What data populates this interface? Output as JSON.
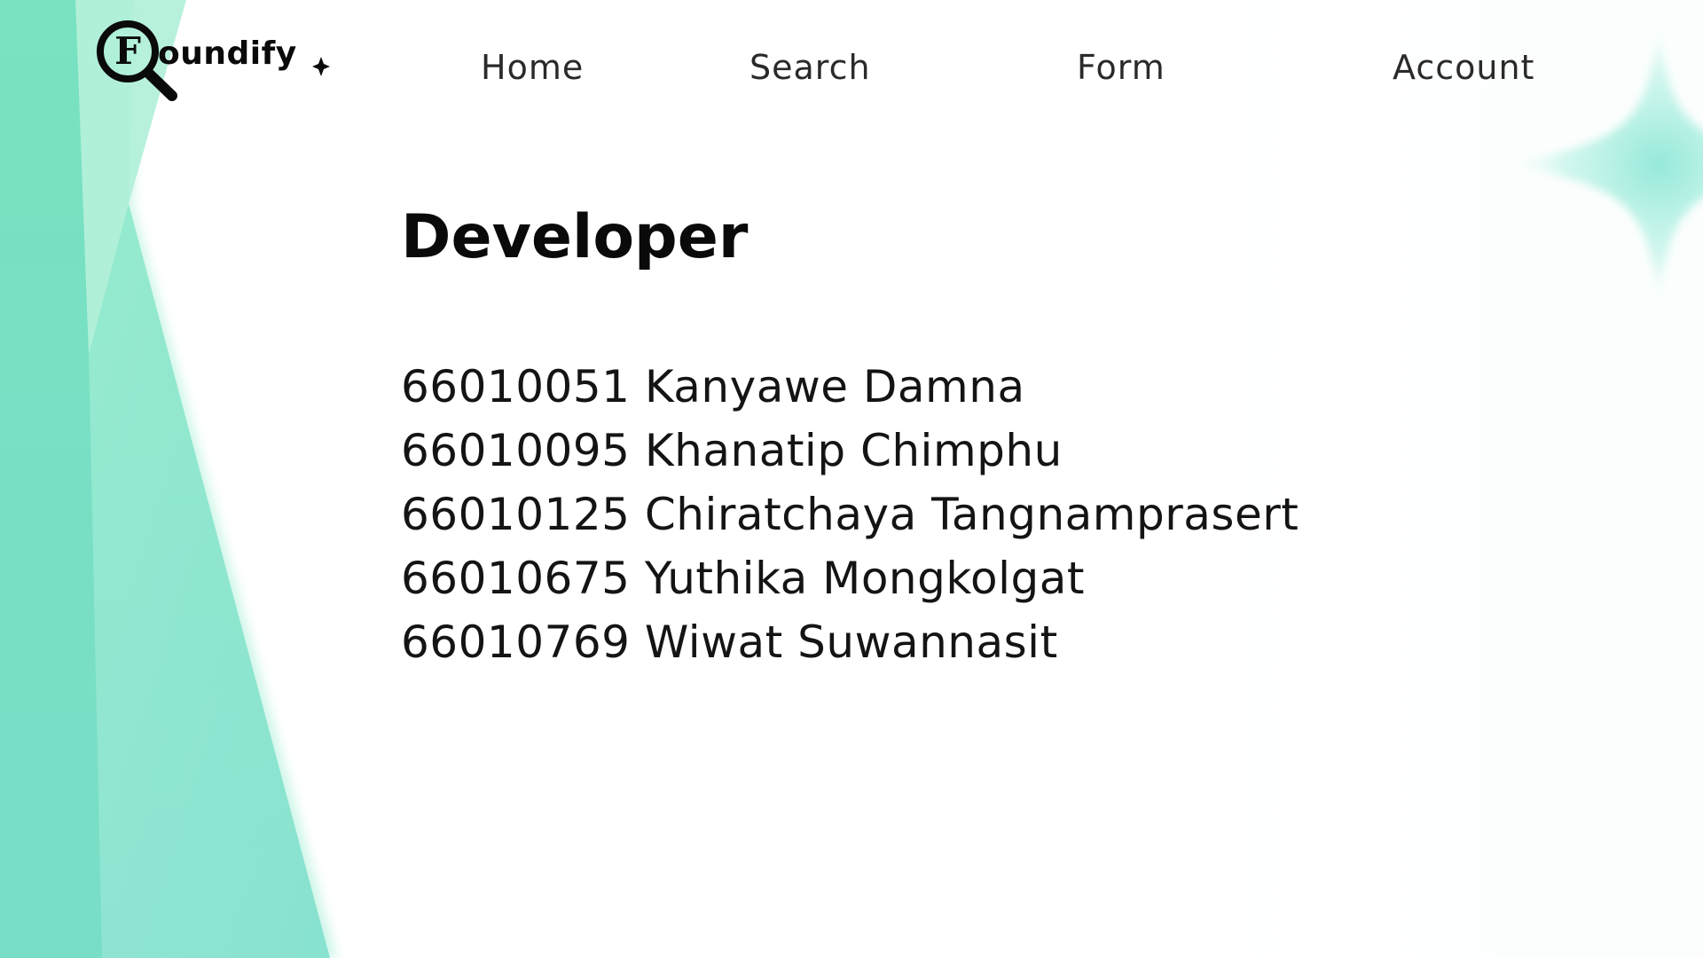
{
  "brand": {
    "logo_text": "Foundify",
    "accent_color": "#7fe3c8"
  },
  "nav": {
    "home": "Home",
    "search": "Search",
    "form": "Form",
    "account": "Account"
  },
  "main": {
    "title": "Developer",
    "developers": [
      "66010051 Kanyawe Damna",
      "66010095 Khanatip Chimphu",
      "66010125 Chiratchaya Tangnamprasert",
      "66010675 Yuthika Mongkolgat",
      "66010769 Wiwat Suwannasit"
    ]
  }
}
